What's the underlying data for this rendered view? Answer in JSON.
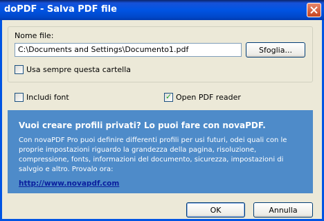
{
  "window": {
    "title": "doPDF - Salva PDF file"
  },
  "file": {
    "label": "Nome file:",
    "value": "C:\\Documents and Settings\\Documento1.pdf",
    "browse_label": "Sfoglia..."
  },
  "options": {
    "always_use_folder_label": "Usa sempre questa cartella",
    "always_use_folder_checked": false,
    "include_font_label": "Includi font",
    "include_font_checked": false,
    "open_reader_label": "Open PDF reader",
    "open_reader_checked": true
  },
  "promo": {
    "title": "Vuoi creare profili privati? Lo puoi fare con novaPDF.",
    "body": "Con novaPDF Pro puoi definire differenti profili per usi futuri, odei quali con le proprie impostazioni riguardo la grandezza della pagina, risoluzione, compressione, fonts, informazioni del documento, sicurezza, impostazioni di salvgio e altro. Provalo ora:",
    "link": "http://www.novapdf.com"
  },
  "buttons": {
    "ok": "OK",
    "cancel": "Annulla"
  },
  "colors": {
    "title_bar": "#0054E3",
    "promo_background": "#4E8BC9",
    "dialog_background": "#ECE9D8"
  }
}
